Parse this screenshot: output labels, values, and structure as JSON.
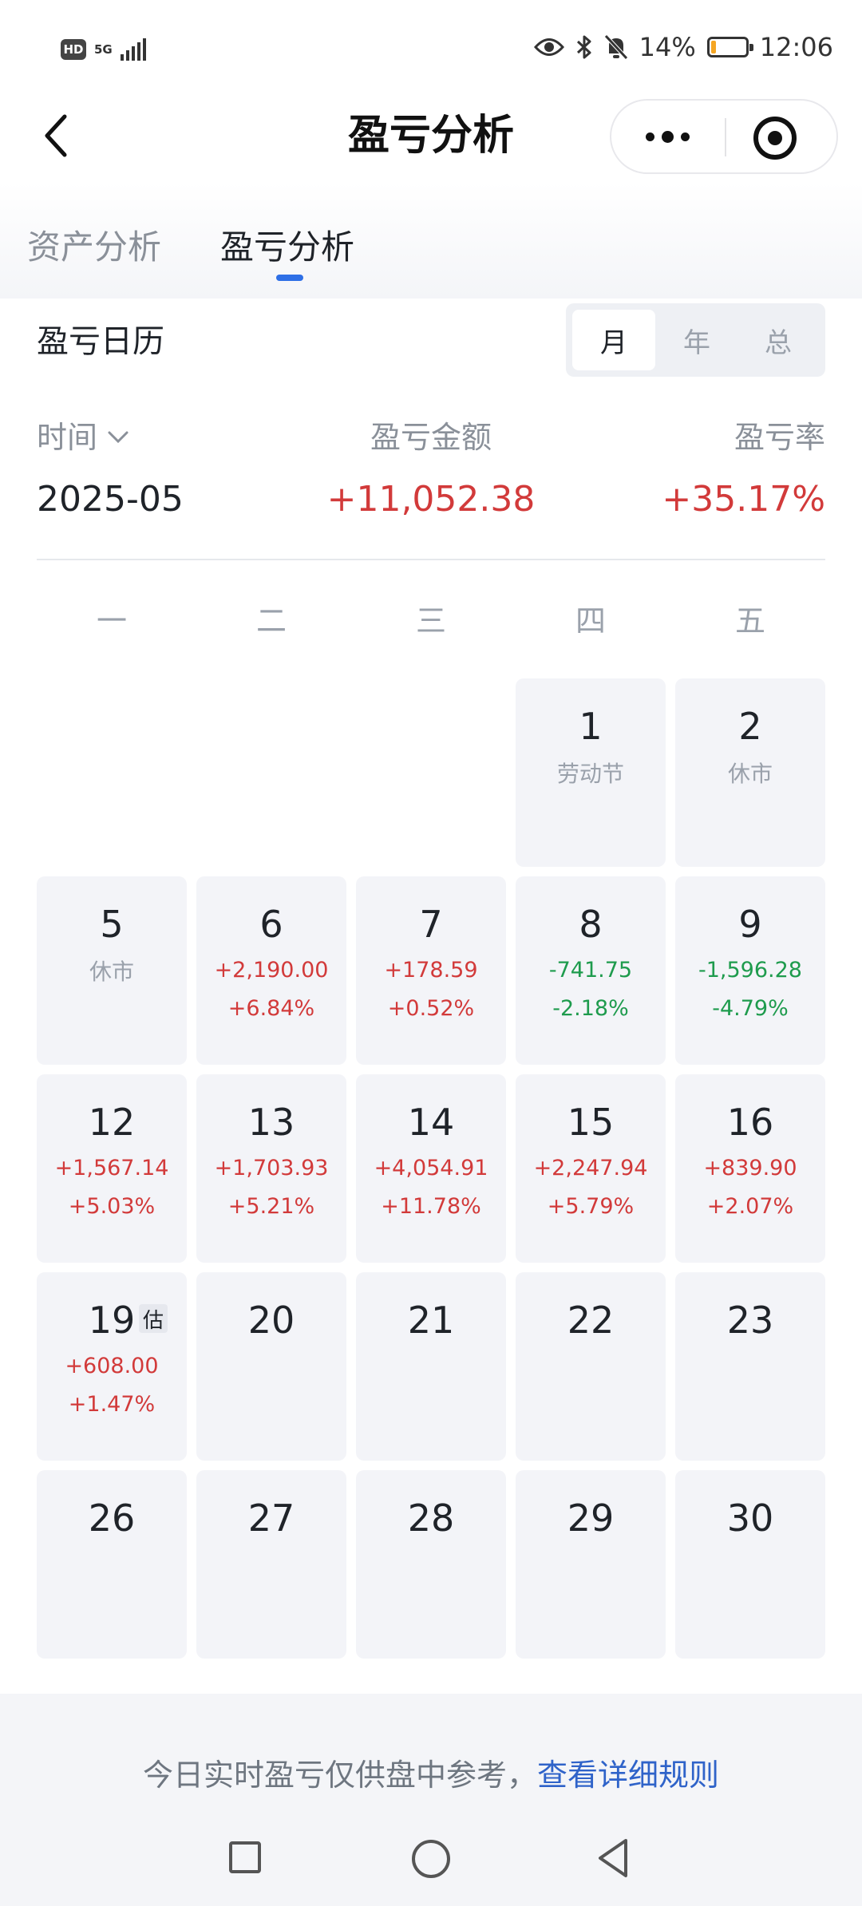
{
  "status_bar": {
    "hd": "HD",
    "network": "5G",
    "battery_percent": "14%",
    "battery_level": 0.14,
    "time": "12:06",
    "icons": [
      "eye-icon",
      "bluetooth-icon",
      "bell-off-icon"
    ]
  },
  "nav": {
    "title": "盈亏分析",
    "back_icon": "chevron-left-icon",
    "more_icon": "more-dots-icon",
    "close_icon": "target-close-icon"
  },
  "tabs": [
    {
      "label": "资产分析",
      "active": false
    },
    {
      "label": "盈亏分析",
      "active": true
    }
  ],
  "calendar": {
    "title": "盈亏日历",
    "segments": [
      {
        "label": "月",
        "active": true
      },
      {
        "label": "年",
        "active": false
      },
      {
        "label": "总",
        "active": false
      }
    ]
  },
  "summary": {
    "time_label": "时间",
    "amount_label": "盈亏金额",
    "rate_label": "盈亏率",
    "month": "2025-05",
    "amount": "+11,052.38",
    "rate": "+35.17%"
  },
  "weekdays": [
    "一",
    "二",
    "三",
    "四",
    "五"
  ],
  "days": [
    {
      "day": "",
      "empty": true
    },
    {
      "day": "",
      "empty": true
    },
    {
      "day": "",
      "empty": true
    },
    {
      "day": "1",
      "note": "劳动节"
    },
    {
      "day": "2",
      "note": "休市"
    },
    {
      "day": "5",
      "note": "休市"
    },
    {
      "day": "6",
      "amount": "+2,190.00",
      "rate": "+6.84%",
      "trend": "up"
    },
    {
      "day": "7",
      "amount": "+178.59",
      "rate": "+0.52%",
      "trend": "up"
    },
    {
      "day": "8",
      "amount": "-741.75",
      "rate": "-2.18%",
      "trend": "down"
    },
    {
      "day": "9",
      "amount": "-1,596.28",
      "rate": "-4.79%",
      "trend": "down"
    },
    {
      "day": "12",
      "amount": "+1,567.14",
      "rate": "+5.03%",
      "trend": "up"
    },
    {
      "day": "13",
      "amount": "+1,703.93",
      "rate": "+5.21%",
      "trend": "up"
    },
    {
      "day": "14",
      "amount": "+4,054.91",
      "rate": "+11.78%",
      "trend": "up"
    },
    {
      "day": "15",
      "amount": "+2,247.94",
      "rate": "+5.79%",
      "trend": "up"
    },
    {
      "day": "16",
      "amount": "+839.90",
      "rate": "+2.07%",
      "trend": "up"
    },
    {
      "day": "19",
      "amount": "+608.00",
      "rate": "+1.47%",
      "trend": "up",
      "tag": "估"
    },
    {
      "day": "20"
    },
    {
      "day": "21"
    },
    {
      "day": "22"
    },
    {
      "day": "23"
    },
    {
      "day": "26"
    },
    {
      "day": "27"
    },
    {
      "day": "28"
    },
    {
      "day": "29"
    },
    {
      "day": "30"
    }
  ],
  "footer": {
    "text": "今日实时盈亏仅供盘中参考，",
    "link": "查看详细规则"
  },
  "system_nav": [
    "recents-square-icon",
    "home-circle-icon",
    "back-triangle-icon"
  ],
  "colors": {
    "profit": "#d23a3a",
    "loss": "#1e9b4d",
    "accent": "#2e6fe6",
    "link": "#2f63c9"
  }
}
